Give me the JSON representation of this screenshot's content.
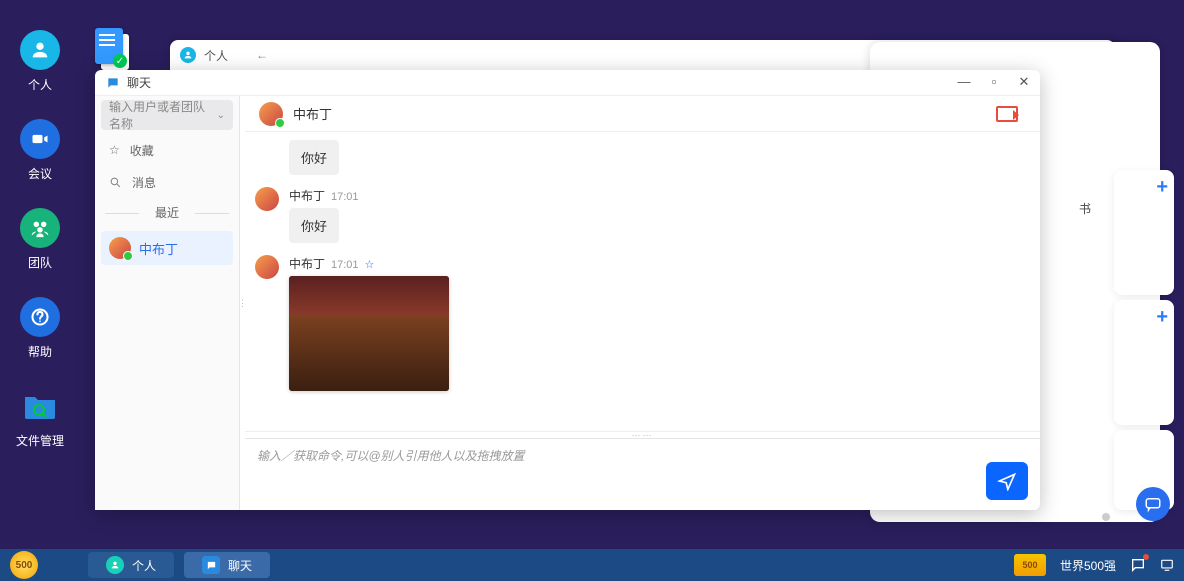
{
  "dock": {
    "items": [
      {
        "label": "个人",
        "icon": "person",
        "bg": "#19b6e8"
      },
      {
        "label": "会议",
        "icon": "video",
        "bg": "#1f6fe0"
      },
      {
        "label": "团队",
        "icon": "team",
        "bg": "#18b37a"
      },
      {
        "label": "帮助",
        "icon": "help",
        "bg": "#1f6fe0"
      },
      {
        "label": "文件管理",
        "icon": "folder",
        "bg": "transparent"
      }
    ]
  },
  "bg_window": {
    "personal_title": "个人",
    "book_char": "书"
  },
  "chat": {
    "window_title": "聊天",
    "search_placeholder": "输入用户或者团队名称",
    "side": {
      "favorites": "收藏",
      "messages": "消息",
      "recent_section": "最近"
    },
    "contact": {
      "name": "中布丁"
    },
    "header_name": "中布丁",
    "msgs": [
      {
        "name": "",
        "time": "",
        "text": "你好",
        "av": false
      },
      {
        "name": "中布丁",
        "time": "17:01",
        "text": "你好",
        "av": true
      },
      {
        "name": "中布丁",
        "time": "17:01",
        "text": "",
        "image": true,
        "star": "☆",
        "av": true
      }
    ],
    "composer_placeholder": "输入／获取命令,可以@别人引用他人以及拖拽放置"
  },
  "taskbar": {
    "items": [
      {
        "label": "个人",
        "icon": "person",
        "bg": "#17b1d8"
      },
      {
        "label": "聊天",
        "icon": "chat",
        "bg": "#2a8ae0",
        "active": true
      }
    ],
    "brand": "世界500强",
    "logo": "500"
  }
}
